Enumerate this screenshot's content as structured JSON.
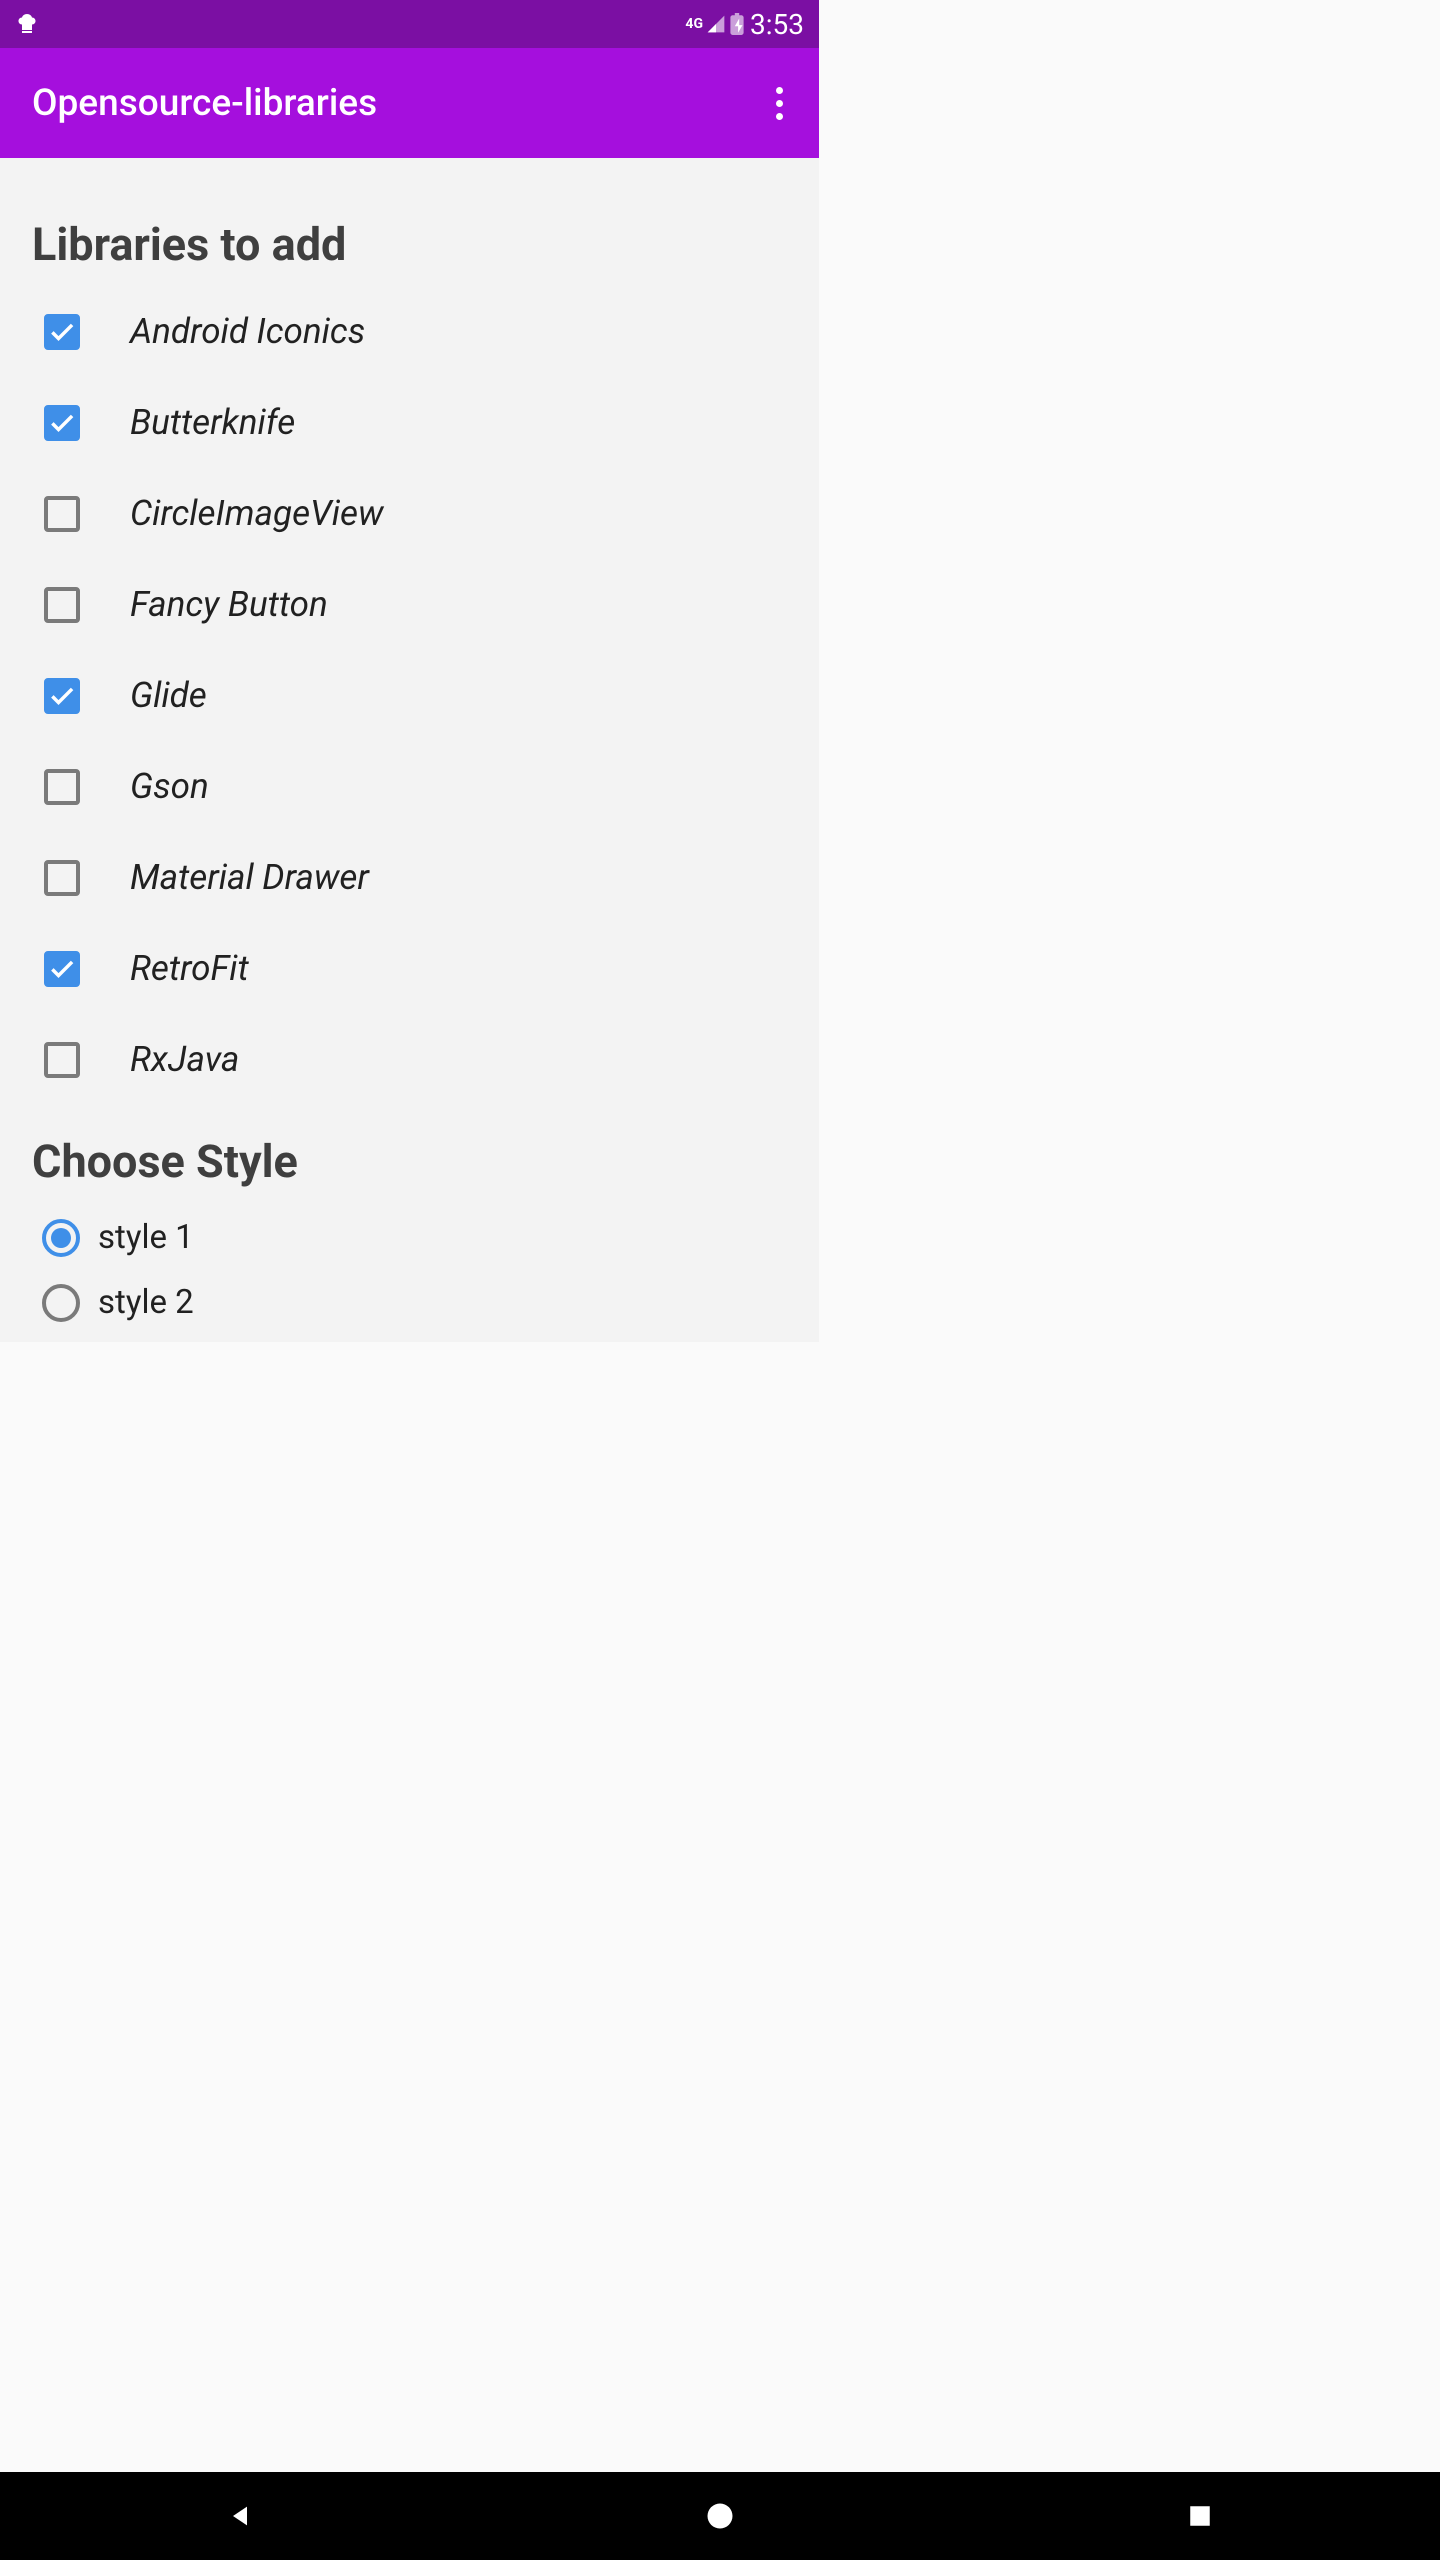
{
  "status": {
    "network": "4G",
    "time": "3:53"
  },
  "app": {
    "title": "Opensource-libraries"
  },
  "sections": {
    "libraries": {
      "title": "Libraries to add",
      "items": [
        {
          "label": "Android Iconics",
          "checked": true
        },
        {
          "label": "Butterknife",
          "checked": true
        },
        {
          "label": "CircleImageView",
          "checked": false
        },
        {
          "label": "Fancy Button",
          "checked": false
        },
        {
          "label": "Glide",
          "checked": true
        },
        {
          "label": "Gson",
          "checked": false
        },
        {
          "label": "Material Drawer",
          "checked": false
        },
        {
          "label": "RetroFit",
          "checked": true
        },
        {
          "label": "RxJava",
          "checked": false
        }
      ]
    },
    "style": {
      "title": "Choose Style",
      "options": [
        {
          "label": "style 1",
          "selected": true
        },
        {
          "label": "style 2",
          "selected": false
        }
      ]
    }
  }
}
